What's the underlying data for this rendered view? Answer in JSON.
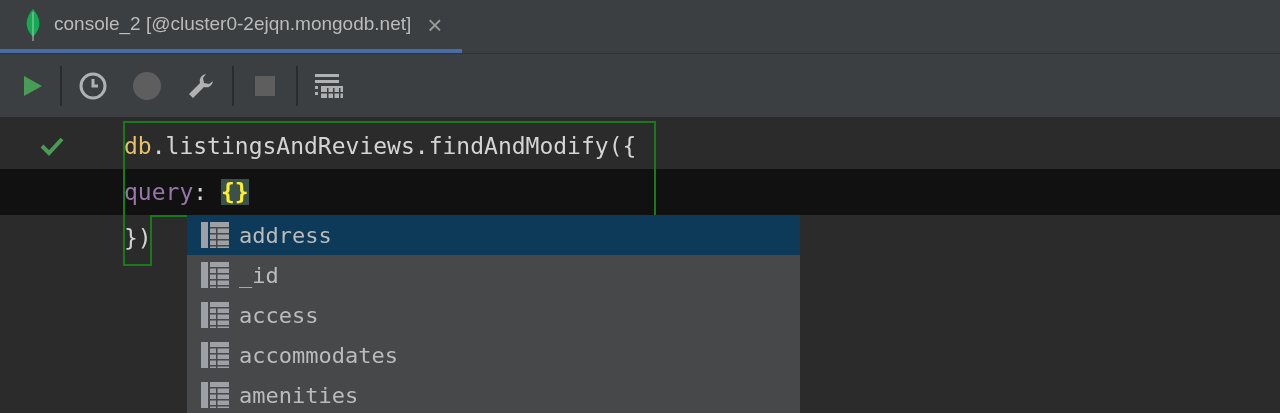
{
  "tabs": [
    {
      "label": "console_2 [@cluster0-2ejqn.mongodb.net]",
      "close": "×",
      "selected": true
    }
  ],
  "toolbar": [
    {
      "kind": "run",
      "disabled": false
    },
    {
      "kind": "history",
      "disabled": false
    },
    {
      "kind": "record",
      "disabled": true
    },
    {
      "kind": "settings",
      "disabled": false
    },
    {
      "kind": "stop",
      "disabled": true
    },
    {
      "kind": "table",
      "disabled": false
    }
  ],
  "editor": {
    "lines": [
      {
        "executed": true,
        "current": false,
        "tokens": [
          {
            "kind": "global",
            "text": "db"
          },
          {
            "kind": "plain",
            "text": ".listingsAndReviews.findAndModify({"
          }
        ]
      },
      {
        "executed": false,
        "current": true,
        "tokens": [
          {
            "kind": "property",
            "text": "query"
          },
          {
            "kind": "plain",
            "text": ": "
          },
          {
            "kind": "brace-match",
            "text": "{}"
          }
        ]
      },
      {
        "executed": false,
        "current": false,
        "tokens": [
          {
            "kind": "plain",
            "text": "})"
          }
        ]
      }
    ]
  },
  "completion": {
    "items": [
      {
        "label": "address",
        "selected": true
      },
      {
        "label": "_id",
        "selected": false
      },
      {
        "label": "access",
        "selected": false
      },
      {
        "label": "accommodates",
        "selected": false
      },
      {
        "label": "amenities",
        "selected": false
      }
    ]
  }
}
